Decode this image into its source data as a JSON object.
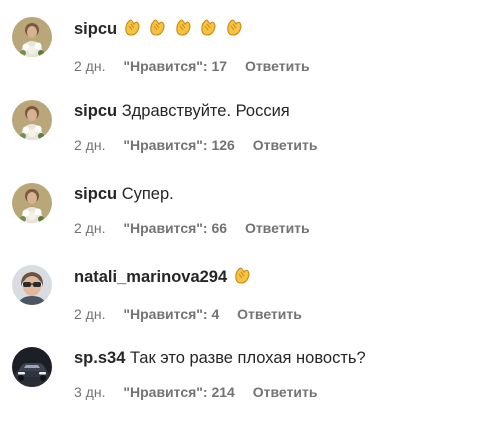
{
  "likes_prefix": "\"Нравится\": ",
  "comments": [
    {
      "username": "sipcu",
      "text": "",
      "emoji": [
        "clapping-hands",
        "clapping-hands",
        "clapping-hands",
        "clapping-hands",
        "clapping-hands"
      ],
      "time": "2 дн.",
      "likes": "\"Нравится\": 17",
      "reply": "Ответить",
      "avatar": "flowers-portrait"
    },
    {
      "username": "sipcu",
      "text": "Здравствуйте. Россия",
      "emoji": [],
      "time": "2 дн.",
      "likes": "\"Нравится\": 126",
      "reply": "Ответить",
      "avatar": "flowers-portrait"
    },
    {
      "username": "sipcu",
      "text": "Супер.",
      "emoji": [],
      "time": "2 дн.",
      "likes": "\"Нравится\": 66",
      "reply": "Ответить",
      "avatar": "flowers-portrait"
    },
    {
      "username": "natali_marinova294",
      "text": "",
      "emoji": [
        "clapping-hands"
      ],
      "time": "2 дн.",
      "likes": "\"Нравится\": 4",
      "reply": "Ответить",
      "avatar": "woman-sunglasses-portrait"
    },
    {
      "username": "sp.s34",
      "text": "Так это разве плохая новость?",
      "emoji": [],
      "time": "3 дн.",
      "likes": "\"Нравится\": 214",
      "reply": "Ответить",
      "avatar": "car-photo"
    }
  ]
}
